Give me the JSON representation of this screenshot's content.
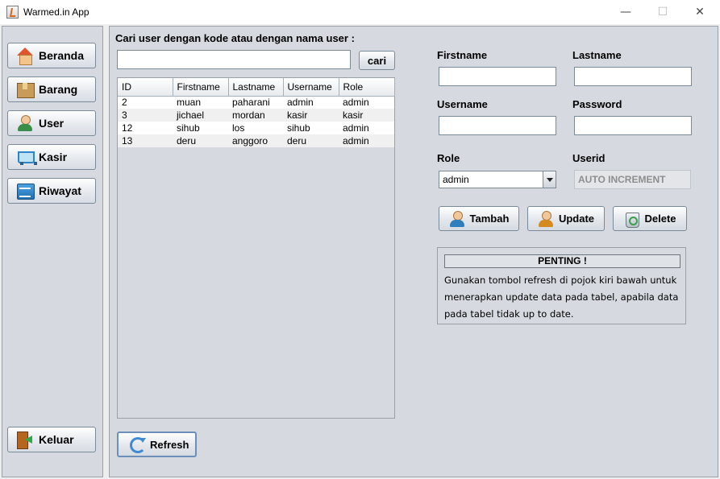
{
  "window": {
    "title": "Warmed.in App",
    "minimize_glyph": "—",
    "maximize_glyph": "☐",
    "close_glyph": "✕"
  },
  "sidebar": {
    "items": [
      {
        "label": "Beranda",
        "icon": "home-icon"
      },
      {
        "label": "Barang",
        "icon": "box-icon"
      },
      {
        "label": "User",
        "icon": "user-icon"
      },
      {
        "label": "Kasir",
        "icon": "cart-icon"
      },
      {
        "label": "Riwayat",
        "icon": "history-icon"
      }
    ],
    "exit_label": "Keluar"
  },
  "search": {
    "label": "Cari user dengan kode atau dengan nama user :",
    "value": "",
    "button_label": "cari"
  },
  "table": {
    "columns": [
      "ID",
      "Firstname",
      "Lastname",
      "Username",
      "Role"
    ],
    "rows": [
      [
        "2",
        "muan",
        "paharani",
        "admin",
        "admin"
      ],
      [
        "3",
        "jichael",
        "mordan",
        "kasir",
        "kasir"
      ],
      [
        "12",
        "sihub",
        "los",
        "sihub",
        "admin"
      ],
      [
        "13",
        "deru",
        "anggoro",
        "deru",
        "admin"
      ]
    ]
  },
  "form": {
    "firstname_label": "Firstname",
    "firstname_value": "",
    "lastname_label": "Lastname",
    "lastname_value": "",
    "username_label": "Username",
    "username_value": "",
    "password_label": "Password",
    "password_value": "",
    "role_label": "Role",
    "role_value": "admin",
    "userid_label": "Userid",
    "userid_value": "AUTO INCREMENT"
  },
  "actions": {
    "add_label": "Tambah",
    "update_label": "Update",
    "delete_label": "Delete",
    "refresh_label": "Refresh"
  },
  "notice": {
    "title": "PENTING !",
    "text": "Gunakan tombol refresh di pojok kiri bawah untuk menerapkan update data pada tabel, apabila data pada tabel tidak up to date."
  }
}
